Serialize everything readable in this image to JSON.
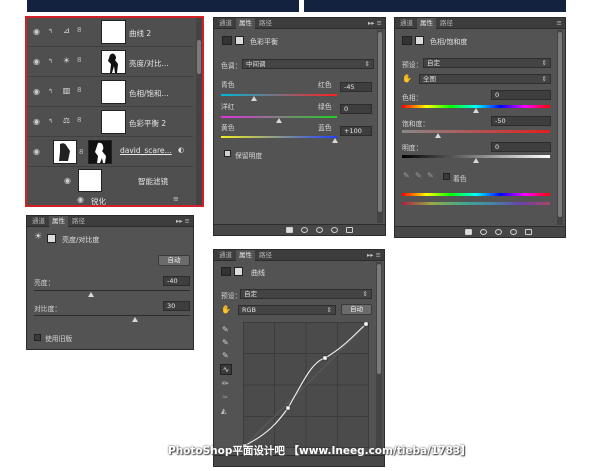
{
  "layers_panel": {
    "layers": [
      {
        "name": "曲线 2",
        "icon": "curves-adjustment-icon"
      },
      {
        "name": "亮度/对比...",
        "icon": "brightness-adjustment-icon"
      },
      {
        "name": "色相/饱和...",
        "icon": "hue-saturation-adjustment-icon"
      },
      {
        "name": "色彩平衡 2",
        "icon": "color-balance-adjustment-icon"
      },
      {
        "name": "david_scare...",
        "icon": "smart-object-icon"
      }
    ],
    "smart_filters_label": "智能滤镜",
    "filter_name": "锐化",
    "highlight_color": "#d32027"
  },
  "color_balance": {
    "tabs": [
      "通道",
      "属性",
      "路径"
    ],
    "title": "色彩平衡",
    "tone_label": "色调：",
    "tone_value": "中间调",
    "rows": [
      {
        "left": "青色",
        "right": "红色",
        "value": "-45"
      },
      {
        "left": "洋红",
        "right": "绿色",
        "value": "0"
      },
      {
        "left": "黄色",
        "right": "蓝色",
        "value": "+100"
      }
    ],
    "preserve_luminosity": "保留明度"
  },
  "hue_saturation": {
    "tabs": [
      "通道",
      "属性",
      "路径"
    ],
    "title": "色相/饱和度",
    "preset_label": "预设：",
    "preset_value": "自定",
    "channel_value": "全图",
    "hue_label": "色相：",
    "hue_value": "0",
    "saturation_label": "饱和度：",
    "saturation_value": "-50",
    "lightness_label": "明度：",
    "lightness_value": "0",
    "colorize_label": "着色"
  },
  "brightness_contrast": {
    "tabs": [
      "通道",
      "属性",
      "路径"
    ],
    "title": "亮度/对比度",
    "auto_label": "自动",
    "brightness_label": "亮度：",
    "brightness_value": "-40",
    "contrast_label": "对比度：",
    "contrast_value": "30",
    "legacy_label": "使用旧版"
  },
  "curves": {
    "tabs": [
      "通道",
      "属性",
      "路径"
    ],
    "title": "曲线",
    "preset_label": "预设：",
    "preset_value": "自定",
    "channel_value": "RGB",
    "auto_label": "自动"
  },
  "watermark": "PhotoShop平面设计吧 【www.Ineeg.com/tieba/1783】",
  "colors": {
    "panel_bg": "#535353",
    "tab_bar": "#3d3d3d",
    "page_bg": "#ffffff",
    "image_strip": "#13233f",
    "highlight": "#d32027"
  }
}
